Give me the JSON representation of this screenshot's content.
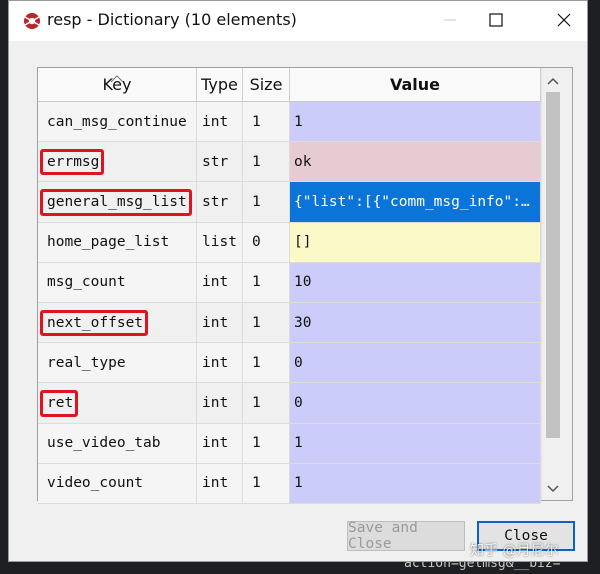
{
  "window": {
    "title": "resp - Dictionary (10 elements)"
  },
  "table": {
    "columns": [
      "Key",
      "Type",
      "Size",
      "Value"
    ],
    "rows": [
      {
        "key": "can_msg_continue",
        "type": "int",
        "size": "1",
        "value": "1",
        "value_color": "#ccccfb",
        "highlighted": false
      },
      {
        "key": "errmsg",
        "type": "str",
        "size": "1",
        "value": "ok",
        "value_color": "#e6cbd3",
        "highlighted": true
      },
      {
        "key": "general_msg_list",
        "type": "str",
        "size": "1",
        "value": "{\"list\":[{\"comm_msg_info\":…",
        "value_color": "#0a74d9",
        "highlighted": true
      },
      {
        "key": "home_page_list",
        "type": "list",
        "size": "0",
        "value": "[]",
        "value_color": "#fbf9c7",
        "highlighted": false
      },
      {
        "key": "msg_count",
        "type": "int",
        "size": "1",
        "value": "10",
        "value_color": "#ccccfb",
        "highlighted": false
      },
      {
        "key": "next_offset",
        "type": "int",
        "size": "1",
        "value": "30",
        "value_color": "#ccccfb",
        "highlighted": true
      },
      {
        "key": "real_type",
        "type": "int",
        "size": "1",
        "value": "0",
        "value_color": "#ccccfb",
        "highlighted": false
      },
      {
        "key": "ret",
        "type": "int",
        "size": "1",
        "value": "0",
        "value_color": "#ccccfb",
        "highlighted": true
      },
      {
        "key": "use_video_tab",
        "type": "int",
        "size": "1",
        "value": "1",
        "value_color": "#ccccfb",
        "highlighted": false
      },
      {
        "key": "video_count",
        "type": "int",
        "size": "1",
        "value": "1",
        "value_color": "#ccccfb",
        "highlighted": false
      }
    ],
    "selected_row_text_color": "#ffffff",
    "highlight_box_color": "#e0141e"
  },
  "buttons": {
    "save_and_close": "Save and Close",
    "close": "Close"
  },
  "icons": {
    "app": "spyder-icon",
    "minimize": "minimize-icon",
    "maximize": "maximize-icon",
    "close": "close-icon"
  },
  "background": {
    "code_snippet": "action=getmsg&__biz="
  },
  "watermark": "知乎 @月尼尔"
}
